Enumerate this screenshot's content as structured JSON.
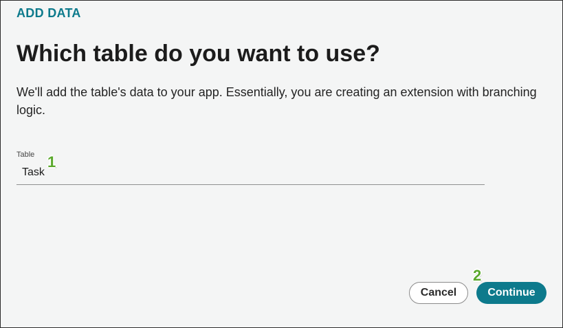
{
  "header": {
    "eyebrow": "ADD DATA",
    "title": "Which table do you want to use?",
    "description": "We'll add the table's data to your app. Essentially, you are creating an extension with branching logic."
  },
  "form": {
    "table_label": "Table",
    "table_value": "Task"
  },
  "annotations": {
    "step_1": "1",
    "step_2": "2"
  },
  "actions": {
    "cancel_label": "Cancel",
    "continue_label": "Continue"
  },
  "colors": {
    "accent": "#0d7a8c",
    "step_marker": "#5aa82c",
    "background": "#f4f5f5"
  }
}
